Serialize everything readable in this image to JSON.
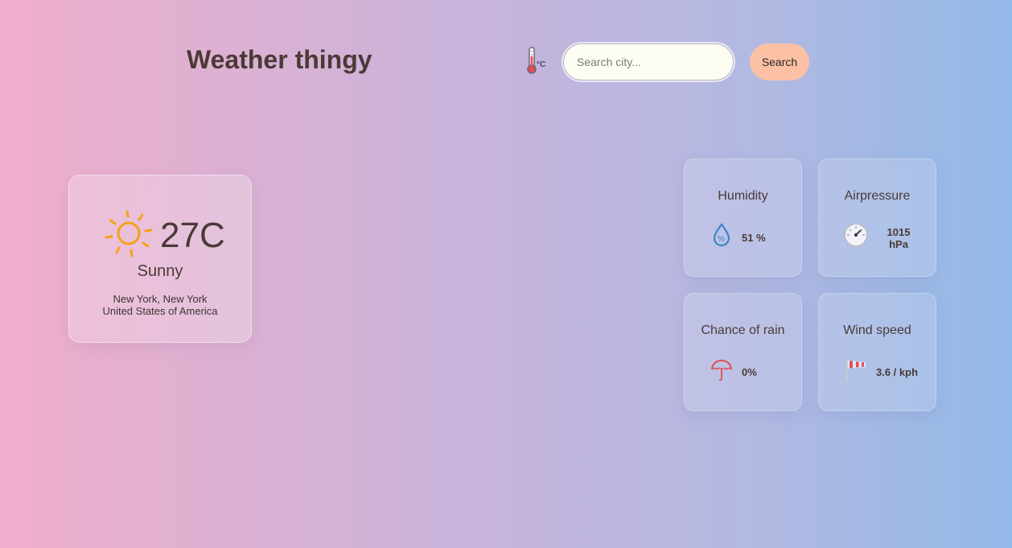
{
  "header": {
    "title": "Weather thingy",
    "unit_toggle_label": "°C",
    "search_placeholder": "Search city...",
    "search_value": "",
    "search_button_label": "Search"
  },
  "current": {
    "icon": "sun-icon",
    "temperature": "27C",
    "condition": "Sunny",
    "location_line1": "New York, New York",
    "location_line2": "United States of America"
  },
  "stats": {
    "humidity": {
      "title": "Humidity",
      "value": "51 %",
      "icon": "humidity-drop-icon"
    },
    "pressure": {
      "title": "Airpressure",
      "value_line1": "1015",
      "value_line2": "hPa",
      "icon": "barometer-gauge-icon"
    },
    "rain": {
      "title": "Chance of rain",
      "value": "0%",
      "icon": "umbrella-icon"
    },
    "wind": {
      "title": "Wind speed",
      "value": "3.6 / kph",
      "icon": "windsock-icon"
    }
  },
  "colors": {
    "accent_button": "#fcc1a5",
    "text_primary": "#4a3a36",
    "sun": "#f4a21c",
    "humidity": "#3a86c8",
    "rain": "#e14f53",
    "wind": "#e14f53"
  }
}
